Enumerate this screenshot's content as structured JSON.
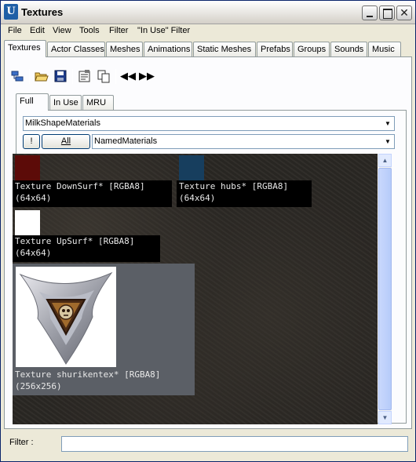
{
  "window": {
    "title": "Textures",
    "app_icon": "unreal-icon",
    "controls": [
      "minimize-icon",
      "maximize-icon",
      "close-icon"
    ]
  },
  "menu": {
    "items": [
      "File",
      "Edit",
      "View",
      "Tools",
      "Filter",
      "\"In Use\" Filter"
    ]
  },
  "main_tabs": {
    "items": [
      "Textures",
      "Actor Classes",
      "Meshes",
      "Animations",
      "Static Meshes",
      "Prefabs",
      "Groups",
      "Sounds",
      "Music"
    ],
    "active": "Textures"
  },
  "toolbar": {
    "icons": [
      "browse-icon",
      "open-folder-icon",
      "save-icon",
      "properties-icon",
      "copy-icon",
      "previous-icon",
      "next-icon"
    ]
  },
  "sub_tabs": {
    "items": [
      "Full",
      "In Use",
      "MRU"
    ],
    "active": "Full"
  },
  "package_combo": {
    "value": "MilkShapeMaterials"
  },
  "group_row": {
    "toggle_label": "!",
    "all_label": "All",
    "group_value": "NamedMaterials"
  },
  "textures": [
    {
      "name": "Texture DownSurf* [RGBA8]",
      "size": "(64x64)",
      "color": "#5c0b08"
    },
    {
      "name": "Texture hubs* [RGBA8]",
      "size": "(64x64)",
      "color": "#173e5e"
    },
    {
      "name": "Texture UpSurf* [RGBA8]",
      "size": "(64x64)",
      "color": "#ffffff"
    },
    {
      "name": "Texture shurikentex* [RGBA8]",
      "size": "(256x256)",
      "selected": true
    }
  ],
  "filter": {
    "label": "Filter :",
    "value": ""
  }
}
